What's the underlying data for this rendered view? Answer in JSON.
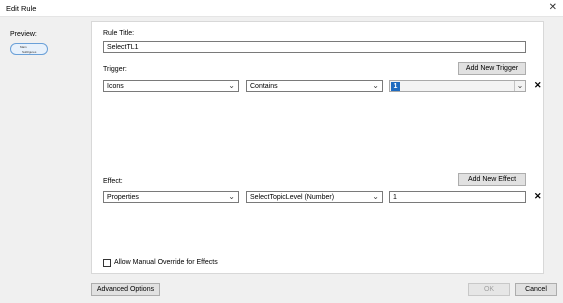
{
  "window": {
    "title": "Edit Rule",
    "close_glyph": "✕"
  },
  "preview": {
    "label": "Preview:",
    "node_line1": "Main",
    "node_line2": "Subfigures"
  },
  "rule_title": {
    "label": "Rule Title:",
    "value": "SelectTL1"
  },
  "trigger": {
    "label": "Trigger:",
    "add_button": "Add New Trigger",
    "field": "Icons",
    "operator": "Contains",
    "value_badge": "1",
    "remove_glyph": "✕"
  },
  "effect": {
    "label": "Effect:",
    "add_button": "Add New Effect",
    "target": "Properties",
    "property": "SelectTopicLevel (Number)",
    "value": "1",
    "remove_glyph": "✕"
  },
  "override": {
    "label": "Allow Manual Override for Effects",
    "checked": false
  },
  "footer": {
    "advanced_button": "Advanced Options",
    "ok_button": "OK",
    "cancel_button": "Cancel"
  },
  "colors": {
    "accent": "#1f6bbf",
    "background": "#f0f0f0"
  },
  "icons": {
    "dropdown": "chevron-down-icon",
    "remove": "close-icon"
  }
}
